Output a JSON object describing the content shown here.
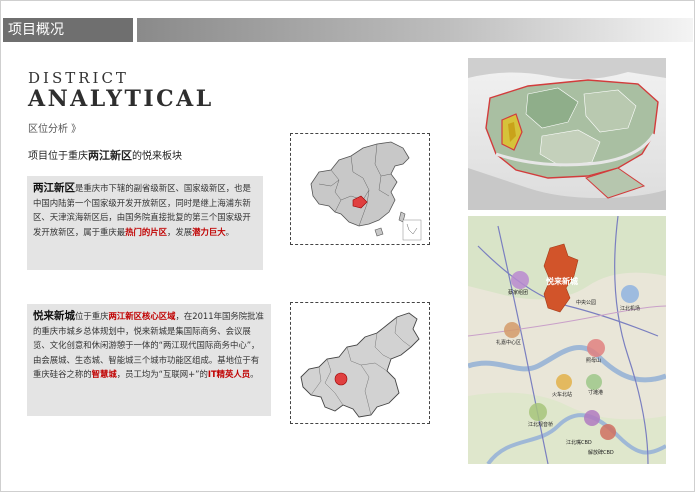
{
  "header": {
    "title": "项目概况"
  },
  "heading": {
    "line1": "DISTRICT",
    "line2": "ANALYTICAL",
    "tag": "区位分析 》"
  },
  "intro": {
    "before": "项目位于重庆",
    "bold": "两江新区",
    "after": "的悦来板块"
  },
  "card1": {
    "head": "两江新区",
    "text1": "是重庆市下辖的副省级新区、国家级新区，也是中国内陆第一个国家级开发开放新区，同时是继上海浦东新区、天津滨海新区后，由国务院直接批复的第三个国家级开发开放新区，属于重庆最",
    "hl1": "热门的片区",
    "text2": "，发展",
    "hl2": "潜力巨大",
    "text3": "。"
  },
  "card2": {
    "head": "悦来新城",
    "text1": "位于重庆",
    "hl1": "两江新区核心区域",
    "text2": "，在2011年国务院批准的重庆市城乡总体规划中，悦来新城是集国际商务、会议展览、文化创意和休闲游憩于一体的“两江现代国际商务中心”，由会展城、生态城、智能城三个城市功能区组成。基地位于有重庆硅谷之称的",
    "hl2": "智慧城",
    "text3": "，员工均为“互联网+”的",
    "hl3": "IT精英人员",
    "text4": "。"
  },
  "plan_map": {
    "main_label": "悦来新城",
    "labels": [
      "蔡家组团",
      "中央公园",
      "江北机场",
      "礼嘉中心区",
      "照母山",
      "寸滩港",
      "火车北站",
      "江北嘴CBD",
      "江北观音桥",
      "解放碑CBD"
    ]
  },
  "colors": {
    "accent_red": "#c00000",
    "header_gray": "#6f6f6f",
    "card_gray": "#e4e4e4",
    "district_orange": "#d2542a"
  }
}
